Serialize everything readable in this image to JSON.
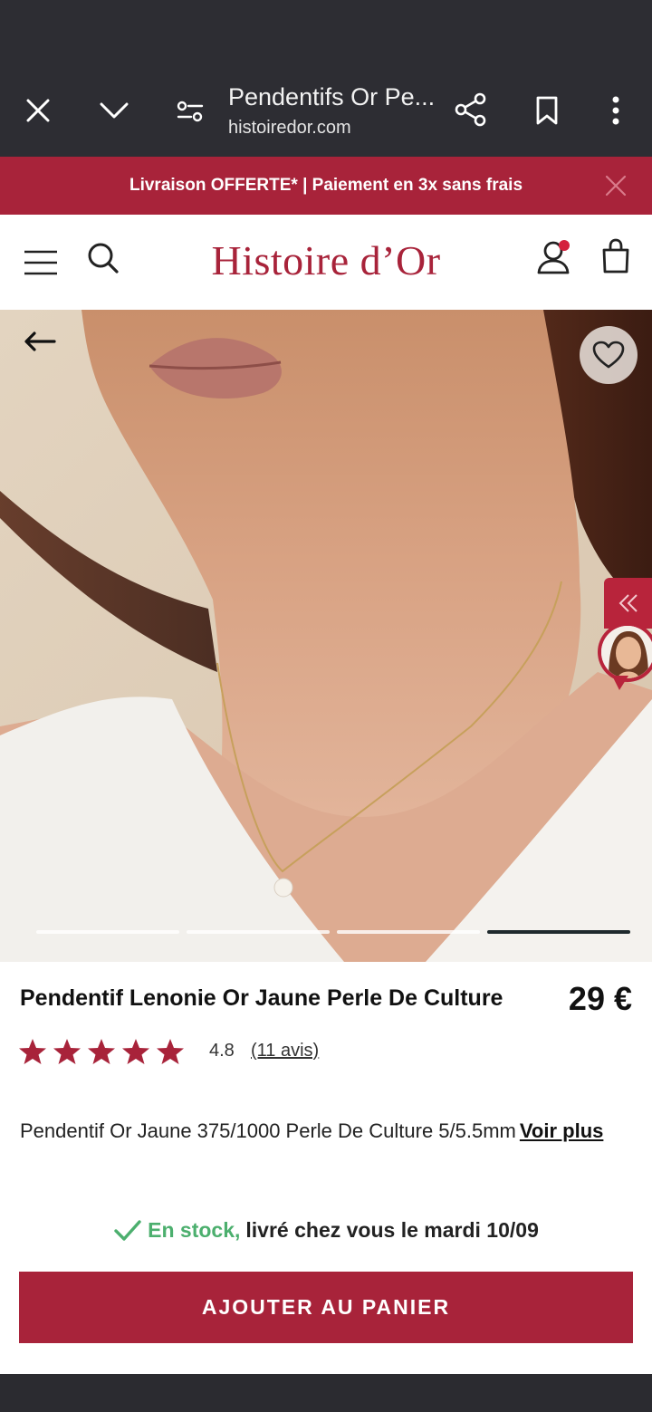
{
  "browser": {
    "tab_title": "Pendentifs Or Pe...",
    "url": "histoiredor.com",
    "icons": [
      "close-icon",
      "chevron-down-icon",
      "site-settings-icon",
      "share-icon",
      "bookmark-icon",
      "more-vert-icon"
    ]
  },
  "promo": {
    "text": "Livraison OFFERTE* | Paiement en 3x sans frais"
  },
  "header": {
    "logo": "Histoire d’Or",
    "icons": [
      "menu-icon",
      "search-icon",
      "account-icon",
      "cart-icon"
    ],
    "accent_color": "#a8233a"
  },
  "gallery": {
    "slide_count": 4,
    "active_slide": 4
  },
  "product": {
    "name": "Pendentif Lenonie Or Jaune Perle De Culture",
    "price": "29 €",
    "rating_value": "4.8",
    "stars": 5,
    "reviews": "(11 avis)",
    "description": "Pendentif Or Jaune 375/1000 Perle De Culture 5/5.5mm",
    "see_more": "Voir plus",
    "stock_status": "En stock,",
    "delivery": "livré chez vous le mardi 10/09",
    "add_to_cart": "AJOUTER AU PANIER"
  }
}
